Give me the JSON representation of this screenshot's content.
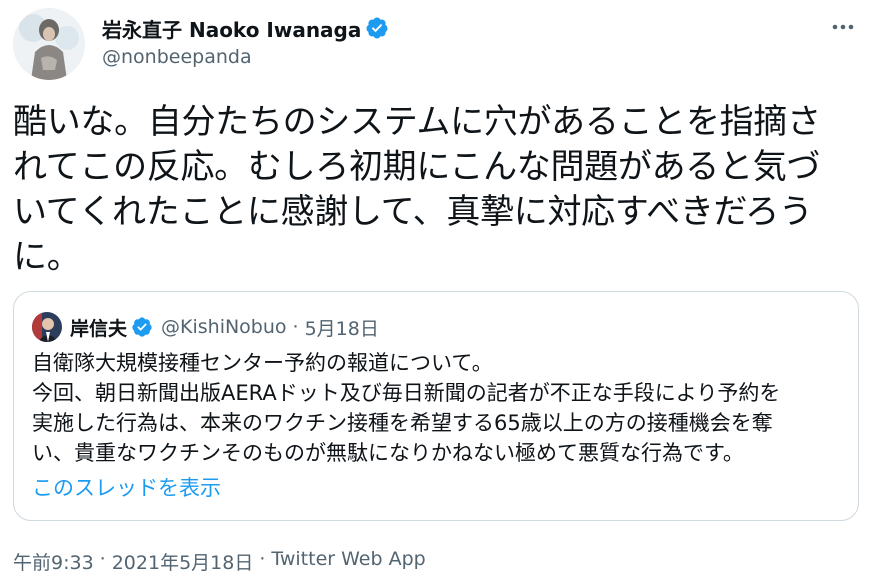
{
  "author": {
    "name": "岩永直子 Naoko Iwanaga",
    "handle": "@nonbeepanda",
    "verified": true
  },
  "tweet": {
    "text": "酷いな。自分たちのシステムに穴があることを指摘さ\nれてこの反応。むしろ初期にこんな問題があると気づ\nいてくれたことに感謝して、真摯に対応すべきだろう\nに。"
  },
  "quoted": {
    "name": "岸信夫",
    "handle": "@KishiNobuo",
    "separator": "·",
    "date": "5月18日",
    "verified": true,
    "text": "自衛隊大規模接種センター予約の報道について。\n今回、朝日新聞出版AERAドット及び毎日新聞の記者が不正な手段により予約を\n実施した行為は、本来のワクチン接種を希望する65歳以上の方の接種機会を奪\nい、貴重なワクチンそのものが無駄になりかねない極めて悪質な行為です。",
    "show_thread_label": "このスレッドを表示"
  },
  "meta": {
    "time": "午前9:33",
    "sep1": "·",
    "date": "2021年5月18日",
    "sep2": "·",
    "source": "Twitter Web App"
  },
  "icons": {
    "verified": "verified-badge-icon",
    "more": "more-icon"
  },
  "colors": {
    "accent": "#1d9bf0",
    "text": "#0f1419",
    "secondary": "#536471",
    "border": "#cfd9de"
  }
}
